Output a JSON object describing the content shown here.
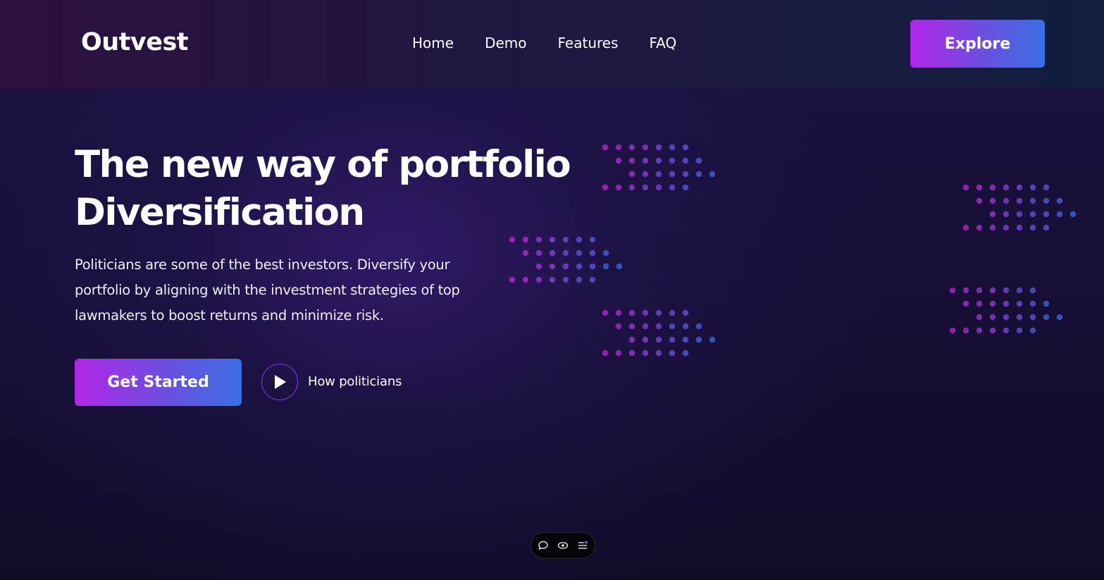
{
  "brand": {
    "name": "Outvest"
  },
  "nav": {
    "items": [
      {
        "label": "Home"
      },
      {
        "label": "Demo"
      },
      {
        "label": "Features"
      },
      {
        "label": "FAQ"
      }
    ],
    "cta_label": "Explore"
  },
  "hero": {
    "title_line1": "The new way of portfolio",
    "title_line2": "Diversification",
    "description": "Politicians are some of the best investors. Diversify your portfolio by aligning with the investment strategies of top lawmakers to boost returns and minimize risk.",
    "primary_cta": "Get Started",
    "secondary_cta": "How politicians"
  },
  "toolbar": {
    "icons": [
      "comment-icon",
      "eye-icon",
      "menu-list-icon"
    ]
  },
  "colors": {
    "accent_start": "#b126e6",
    "accent_end": "#3a6fe4",
    "background": "#1c1242"
  }
}
